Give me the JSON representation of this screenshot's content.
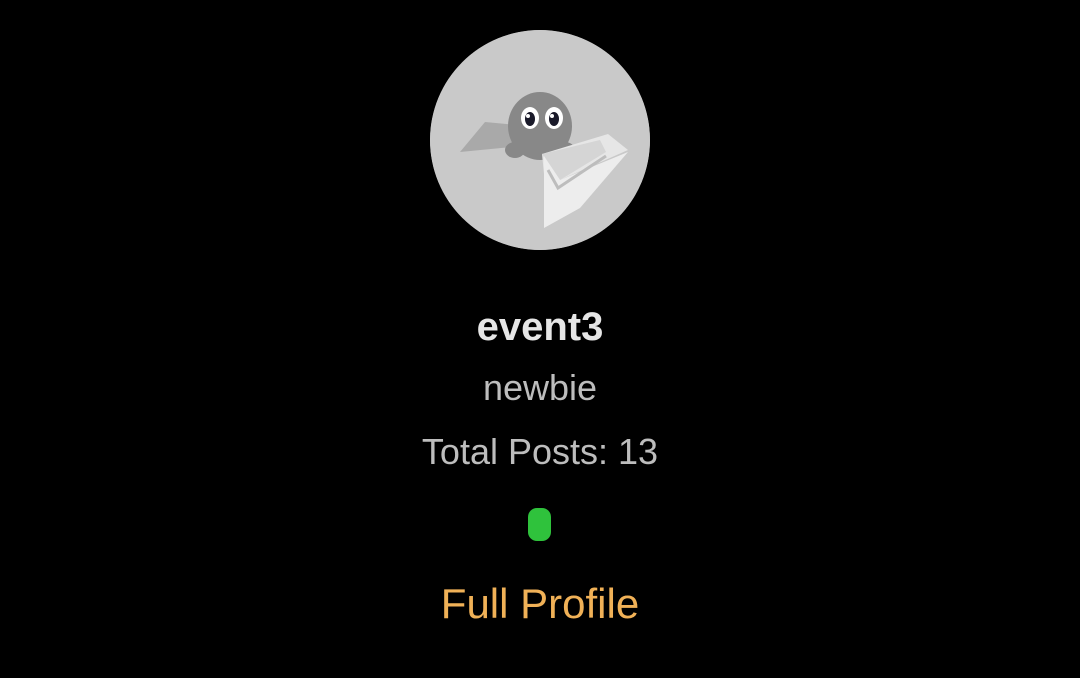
{
  "profile": {
    "username": "event3",
    "rank": "newbie",
    "total_posts": "Total Posts: 13",
    "online_status_color": "#2fc23c",
    "full_profile_label": "Full Profile",
    "avatar_icon": "mascot-in-box-icon"
  },
  "colors": {
    "background": "#000000",
    "link": "#f0b157",
    "avatar_bg": "#c9c9c9"
  }
}
